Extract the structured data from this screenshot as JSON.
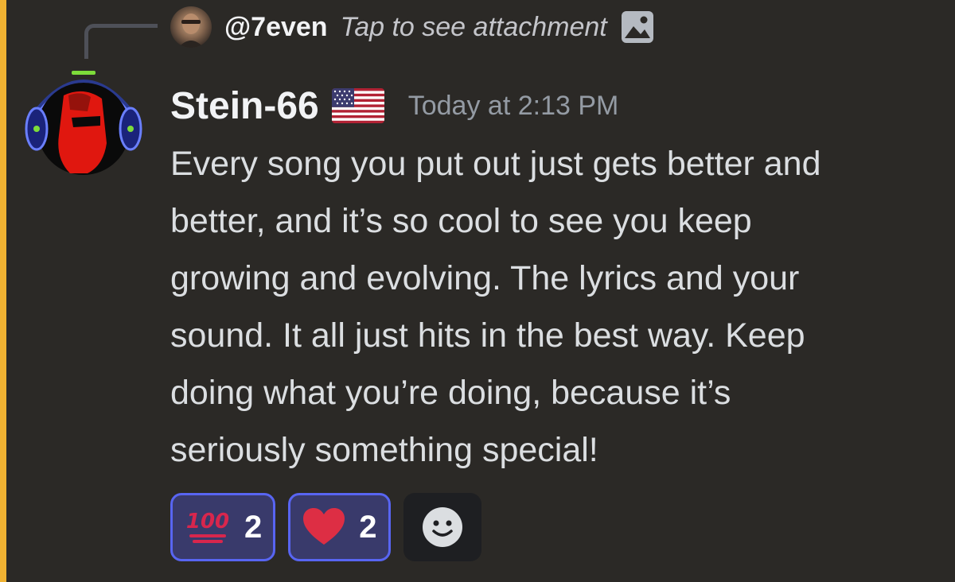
{
  "reply": {
    "author": "@7even",
    "preview_text": "Tap to see attachment",
    "attachment_icon": "image-icon"
  },
  "message": {
    "username": "Stein-66",
    "flag_icon": "us-flag-icon",
    "timestamp": "Today at 2:13 PM",
    "lines": [
      "Every song you put out just gets better and",
      "better, and it’s so cool to see you keep",
      "growing and evolving. The lyrics and your",
      "sound. It all just hits in the best way. Keep",
      "doing what you’re doing, because it’s",
      "seriously something special!"
    ]
  },
  "reactions": [
    {
      "emoji": "hundred-points-icon",
      "emoji_text": "100",
      "count": "2"
    },
    {
      "emoji": "red-heart-icon",
      "count": "2"
    }
  ],
  "add_reaction_icon": "smiley-face-icon",
  "colors": {
    "background": "#2b2926",
    "mention_bar": "#f0b232",
    "reaction_border": "#5865f2",
    "reaction_bg": "#393a6b",
    "timestamp": "#949ba4",
    "body_text": "#dbdee1"
  }
}
